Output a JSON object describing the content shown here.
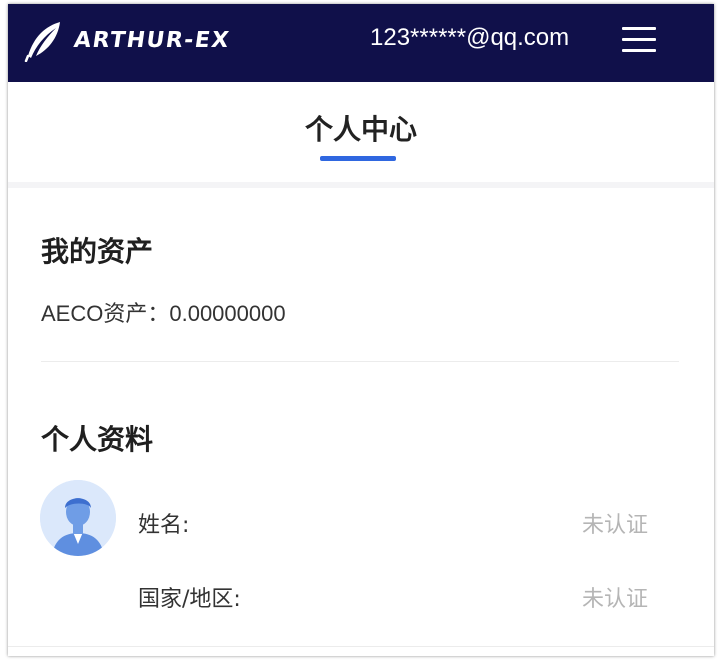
{
  "header": {
    "logo_text": "ARTHUR-EX",
    "user_email": "123******@qq.com",
    "logo_icon": "feather-icon",
    "menu_icon": "hamburger-menu-icon"
  },
  "page": {
    "title": "个人中心"
  },
  "assets": {
    "section_title": "我的资产",
    "label": "AECO资产：",
    "value": "0.00000000"
  },
  "profile": {
    "section_title": "个人资料",
    "avatar_icon": "user-avatar-icon",
    "fields": [
      {
        "label": "姓名:",
        "status": "未认证"
      },
      {
        "label": "国家/地区:",
        "status": "未认证"
      }
    ]
  },
  "colors": {
    "header_bg": "#10104a",
    "accent": "#2f67e0",
    "muted_text": "#b5b5b5"
  }
}
